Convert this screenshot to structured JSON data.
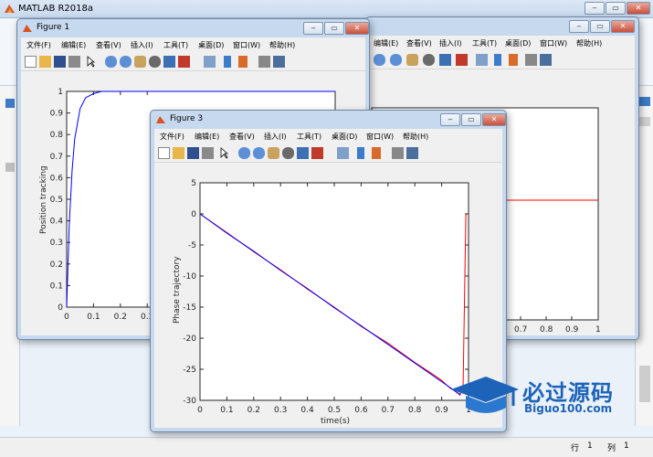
{
  "main_window": {
    "title": "MATLAB R2018a",
    "status_row_label": "行",
    "status_row_value": "1",
    "status_col_label": "列",
    "status_col_value": "1"
  },
  "menu_labels": [
    "文件(F)",
    "编辑(E)",
    "查看(V)",
    "插入(I)",
    "工具(T)",
    "桌面(D)",
    "窗口(W)",
    "帮助(H)"
  ],
  "back_window_menu": [
    "编辑(E)",
    "查看(V)",
    "插入(I)",
    "工具(T)",
    "桌面(D)",
    "窗口(W)",
    "帮助(H)"
  ],
  "back_window_axis": {
    "xticks": [
      "0.7",
      "0.8",
      "0.9",
      "1"
    ],
    "line_value": 2.3,
    "line_color": "#ff0000"
  },
  "figure1": {
    "title": "Figure 1",
    "ylabel": "Position tracking",
    "yticks": [
      "0",
      "0.1",
      "0.2",
      "0.3",
      "0.4",
      "0.5",
      "0.6",
      "0.7",
      "0.8",
      "0.9",
      "1"
    ],
    "xticks": [
      "0",
      "0.1",
      "0.2",
      "0.3"
    ]
  },
  "figure3": {
    "title": "Figure 3",
    "ylabel": "Phase trajectory",
    "xlabel": "time(s)",
    "yticks": [
      "5",
      "0",
      "-5",
      "-10",
      "-15",
      "-20",
      "-25",
      "-30"
    ],
    "xticks": [
      "0",
      "0.1",
      "0.2",
      "0.3",
      "0.4",
      "0.5",
      "0.6",
      "0.7",
      "0.8",
      "0.9",
      "1"
    ]
  },
  "chart_data": [
    {
      "type": "line",
      "title": "",
      "xlabel": "",
      "ylabel": "Position tracking",
      "xlim": [
        0,
        1
      ],
      "ylim": [
        0,
        1
      ],
      "grid": false,
      "series": [
        {
          "color": "#0000ff",
          "x": [
            0,
            0.01,
            0.02,
            0.03,
            0.05,
            0.07,
            0.1,
            0.13,
            0.16,
            0.2,
            0.3,
            0.5,
            1
          ],
          "y": [
            0,
            0.39,
            0.63,
            0.78,
            0.92,
            0.97,
            0.99,
            1.0,
            1.0,
            1.0,
            1.0,
            1.0,
            1.0
          ]
        }
      ]
    },
    {
      "type": "line",
      "title": "",
      "xlabel": "time(s)",
      "ylabel": "Phase trajectory",
      "xlim": [
        0,
        1
      ],
      "ylim": [
        -30,
        5
      ],
      "grid": false,
      "series": [
        {
          "color": "#ff0000",
          "x": [
            0,
            0.1,
            0.2,
            0.3,
            0.4,
            0.5,
            0.6,
            0.7,
            0.8,
            0.86,
            0.9,
            0.93,
            0.96,
            0.97,
            0.98,
            0.99
          ],
          "y": [
            0,
            -3.0,
            -6.1,
            -9.0,
            -12.1,
            -15.0,
            -18.1,
            -20.8,
            -23.9,
            -25.6,
            -26.8,
            -28.0,
            -28.8,
            -29.0,
            -27.5,
            0
          ]
        },
        {
          "color": "#0000ff",
          "x": [
            0,
            0.1,
            0.2,
            0.3,
            0.4,
            0.5,
            0.6,
            0.7,
            0.8,
            0.9,
            0.95,
            0.97
          ],
          "y": [
            0,
            -3.1,
            -6.0,
            -9.1,
            -12.0,
            -15.1,
            -18.0,
            -21.0,
            -24.0,
            -27.0,
            -28.5,
            -29.2
          ]
        }
      ]
    }
  ]
}
